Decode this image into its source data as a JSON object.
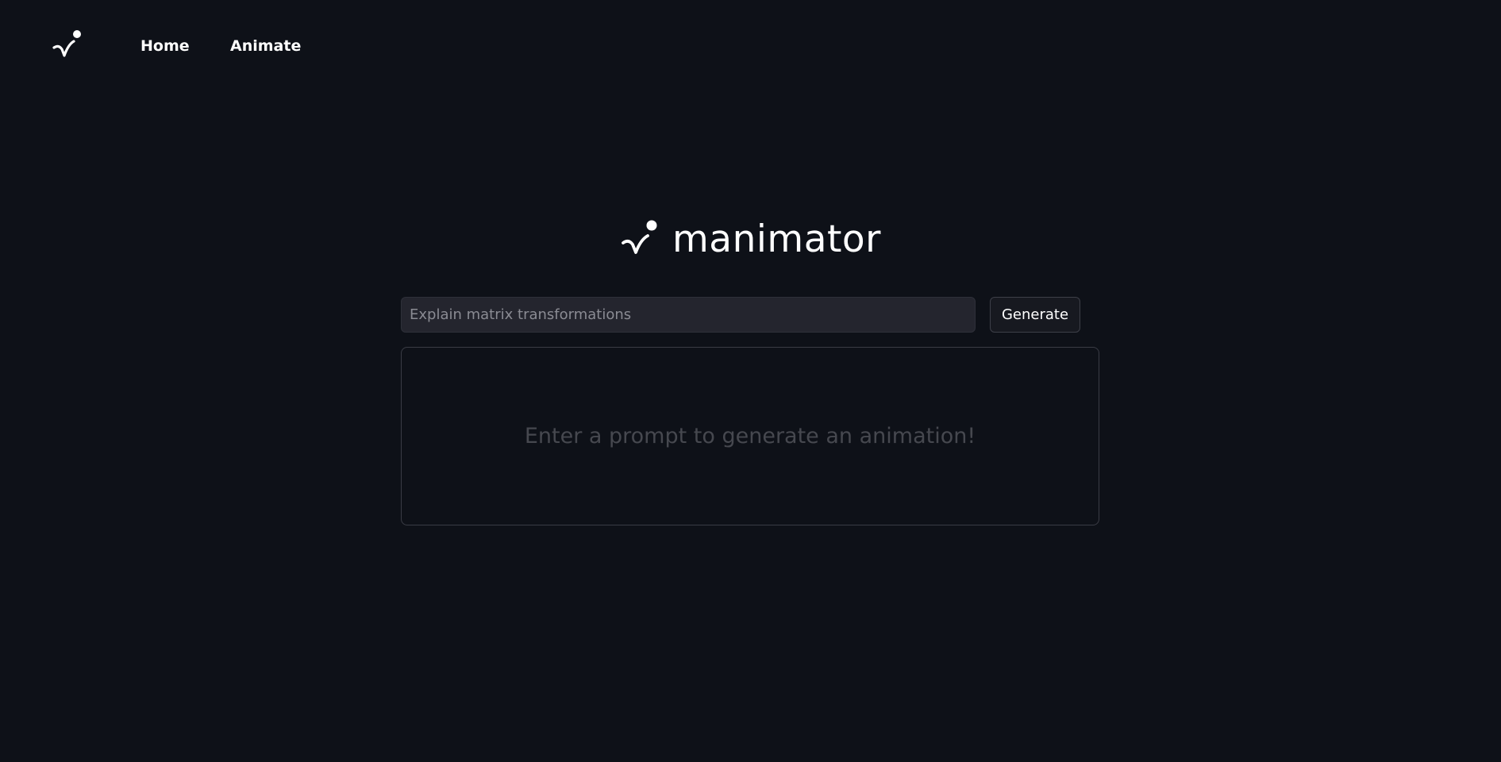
{
  "nav": {
    "logo_icon": "manimator-logo-icon",
    "links": [
      {
        "label": "Home"
      },
      {
        "label": "Animate"
      }
    ]
  },
  "brand": {
    "logo_icon": "manimator-logo-icon",
    "name": "manimator"
  },
  "prompt": {
    "placeholder": "Explain matrix transformations",
    "value": ""
  },
  "generate": {
    "label": "Generate"
  },
  "output": {
    "placeholder_text": "Enter a prompt to generate an animation!"
  },
  "colors": {
    "background": "#0e1118",
    "input_background": "#24252e",
    "text": "#ffffff",
    "muted_text": "#46484f"
  }
}
